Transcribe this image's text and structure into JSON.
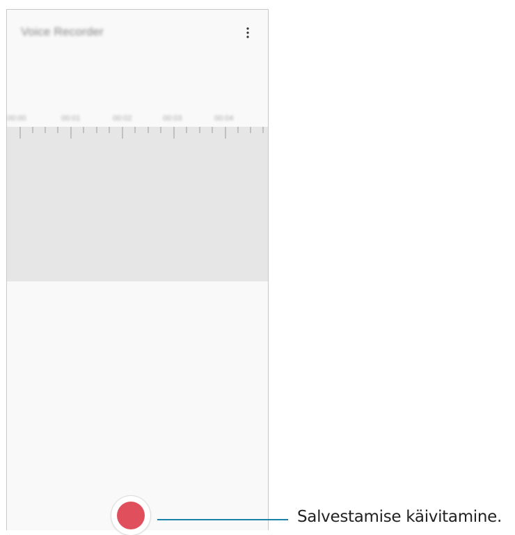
{
  "app": {
    "title": "Voice Recorder",
    "more_icon": "more-vertical-icon"
  },
  "timeline": {
    "labels": [
      "00:00",
      "00:01",
      "00:02",
      "00:03",
      "00:04"
    ]
  },
  "record": {
    "icon": "record-icon",
    "color": "#e0505c"
  },
  "callout": {
    "text": "Salvestamise käivitamine.",
    "line_color": "#1a82a8"
  }
}
